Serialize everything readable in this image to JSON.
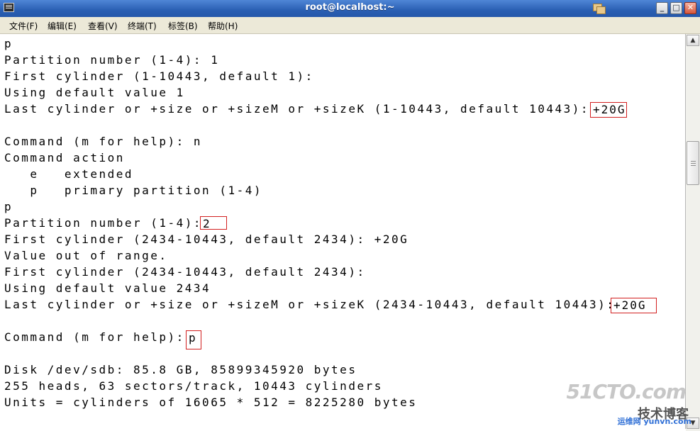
{
  "window": {
    "title": "root@localhost:~",
    "minimize": "_",
    "maximize": "□",
    "close": "✕"
  },
  "menu": [
    "文件(F)",
    "编辑(E)",
    "查看(V)",
    "终端(T)",
    "标签(B)",
    "帮助(H)"
  ],
  "terminal": {
    "lines": [
      "p",
      "Partition number (1-4): 1",
      "First cylinder (1-10443, default 1):",
      "Using default value 1",
      "Last cylinder or +size or +sizeM or +sizeK (1-10443, default 10443):",
      "",
      "Command (m for help): n",
      "Command action",
      "   e   extended",
      "   p   primary partition (1-4)",
      "p",
      "Partition number (1-4):",
      "First cylinder (2434-10443, default 2434): +20G",
      "Value out of range.",
      "First cylinder (2434-10443, default 2434):",
      "Using default value 2434",
      "Last cylinder or +size or +sizeM or +sizeK (2434-10443, default 10443):",
      "",
      "Command (m for help):",
      "",
      "Disk /dev/sdb: 85.8 GB, 85899345920 bytes",
      "255 heads, 63 sectors/track, 10443 cylinders",
      "Units = cylinders of 16065 * 512 = 8225280 bytes"
    ],
    "highlights": [
      "+20G",
      "2",
      "+20G",
      "p"
    ]
  },
  "scrollbar": {
    "up_arrow": "▲",
    "down_arrow": "▼"
  },
  "watermark": {
    "line1": "51CTO.com",
    "line2": "技术博客",
    "line3": "运维网 yunvn.com"
  }
}
